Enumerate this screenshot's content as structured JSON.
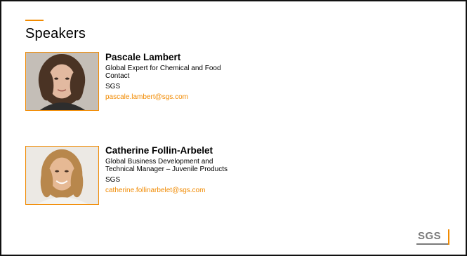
{
  "slide": {
    "title": "Speakers",
    "accent_color": "#f18a00"
  },
  "speakers": [
    {
      "name": "Pascale Lambert",
      "role": "Global Expert for Chemical and Food Contact",
      "org": "SGS",
      "email": "pascale.lambert@sgs.com",
      "photo_icon": "portrait-photo"
    },
    {
      "name": "Catherine Follin-Arbelet",
      "role": "Global Business Development and Technical Manager – Juvenile Products",
      "org": "SGS",
      "email": "catherine.follinarbelet@sgs.com",
      "photo_icon": "portrait-photo"
    }
  ],
  "footer": {
    "logo_text": "SGS"
  }
}
